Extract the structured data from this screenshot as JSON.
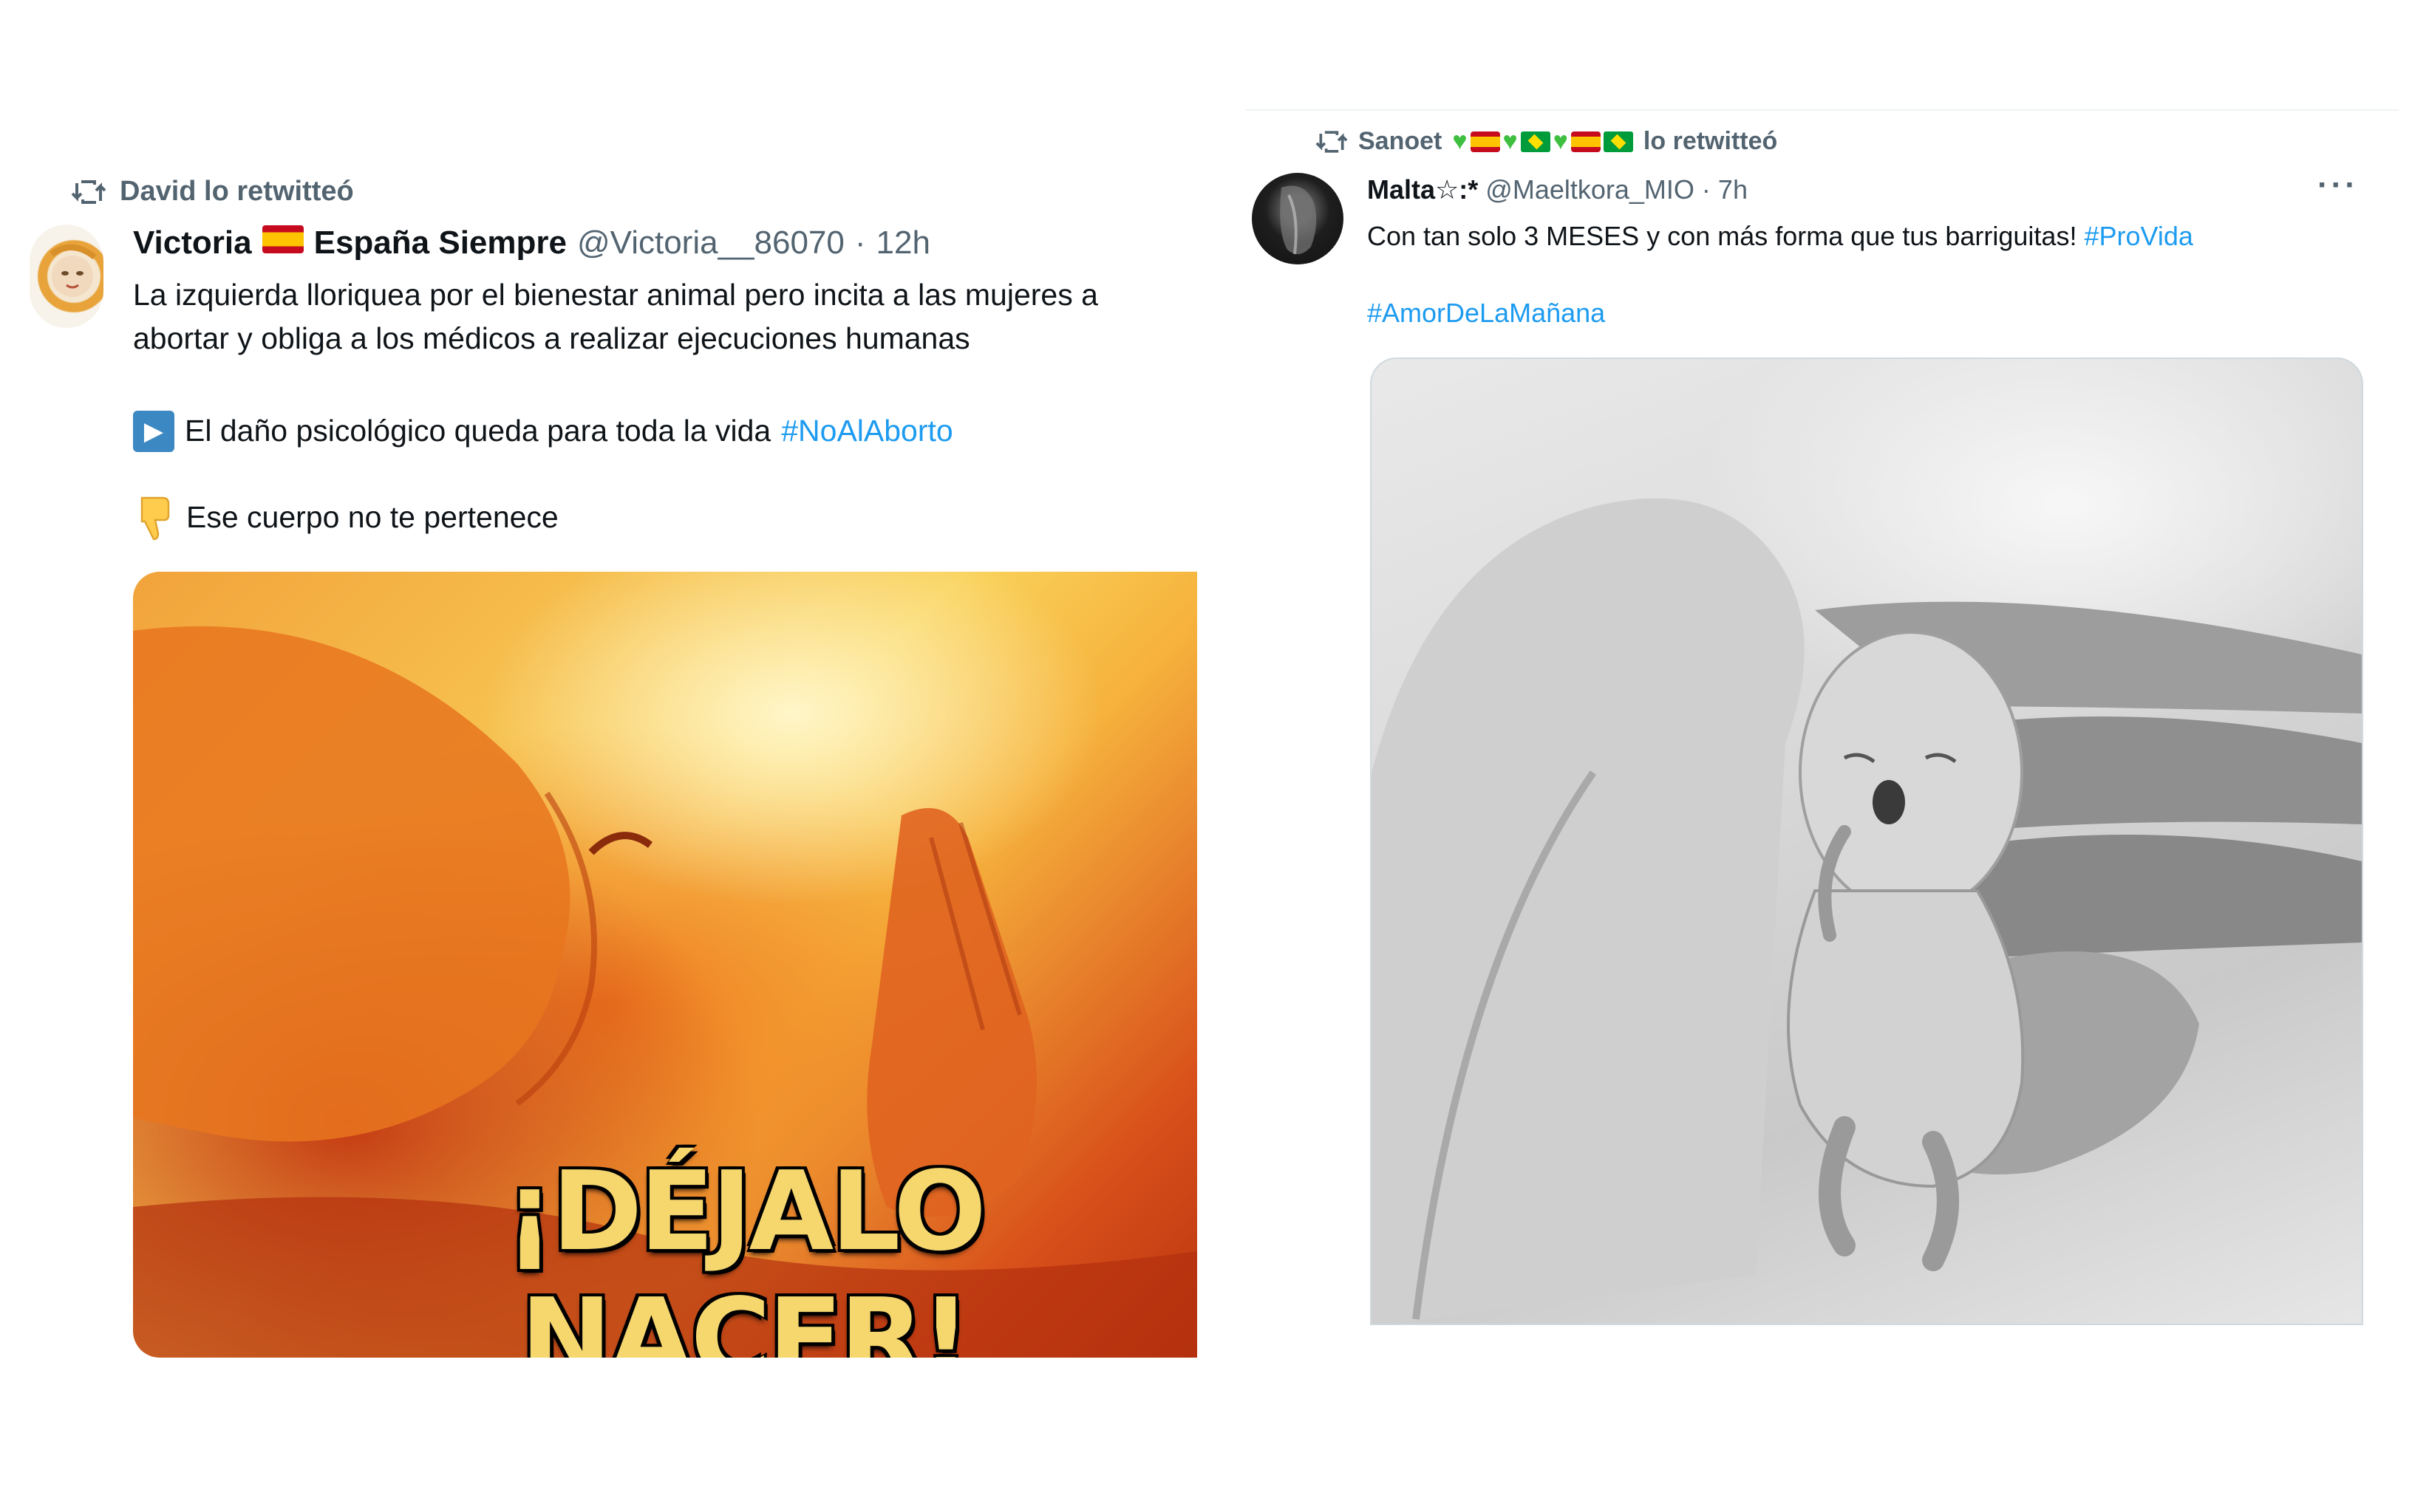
{
  "left_tweet": {
    "retweet_label": "David lo retwitteó",
    "author_name_1": "Victoria",
    "author_name_2": "España Siempre",
    "handle": "@Victoria__86070",
    "dot": "·",
    "time": "12h",
    "line1": "La izquierda lloriquea por el bienestar animal pero incita a las mujeres a",
    "line2": "abortar y obliga a los médicos a realizar ejecuciones humanas",
    "line3_text": "El daño psicológico queda para toda la vida",
    "line3_hashtag": "#NoAlAborto",
    "line4_text": "Ese cuerpo no te pertenece",
    "image_caption": "¡DÉJALO NACER!"
  },
  "right_tweet": {
    "retweet_name": "Sanoet",
    "retweet_suffix": "lo retwitteó",
    "author_name": "Malta☆:*",
    "handle": "@Maeltkora_MIO",
    "dot": "·",
    "time": "7h",
    "line1_text": "Con tan solo 3 MESES y con más forma que tus barriguitas!",
    "line1_hashtag": "#ProVida",
    "line2_hashtag": "#AmorDeLaMañana",
    "more": "···"
  },
  "colors": {
    "link": "#1d9bf0",
    "muted": "#536471",
    "text": "#0f1419"
  }
}
